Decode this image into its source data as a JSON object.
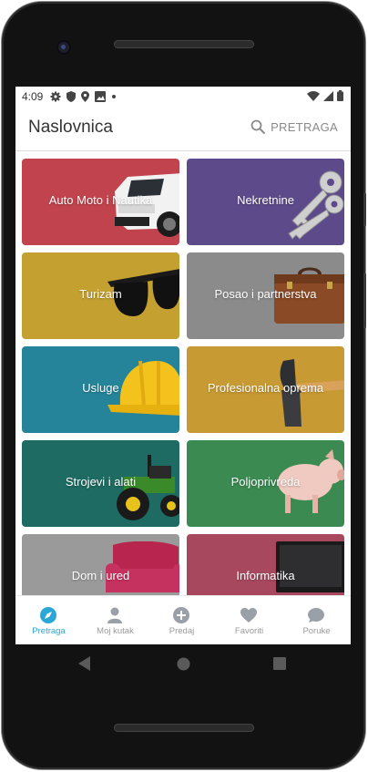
{
  "status_bar": {
    "time": "4:09",
    "left_icons": [
      "gear-icon",
      "shield-icon",
      "location-icon",
      "image-icon",
      "dot-icon"
    ],
    "right_icons": [
      "wifi-icon",
      "cell-signal-icon",
      "battery-icon"
    ]
  },
  "app_bar": {
    "title": "Naslovnica",
    "search_label": "PRETRAGA"
  },
  "categories": [
    {
      "label": "Auto Moto i Nautika",
      "color": "#c1434d",
      "icon": "car-icon"
    },
    {
      "label": "Nekretnine",
      "color": "#5d4a8a",
      "icon": "keys-icon"
    },
    {
      "label": "Turizam",
      "color": "#c4a031",
      "icon": "sunglasses-icon"
    },
    {
      "label": "Posao i partnerstva",
      "color": "#8b8b8b",
      "icon": "briefcase-icon"
    },
    {
      "label": "Usluge",
      "color": "#25849a",
      "icon": "hard-hat-icon"
    },
    {
      "label": "Profesionalna oprema",
      "color": "#c79a33",
      "icon": "hammer-icon"
    },
    {
      "label": "Strojevi i alati",
      "color": "#1d6b62",
      "icon": "tractor-icon"
    },
    {
      "label": "Poljoprivreda",
      "color": "#3b8a52",
      "icon": "pig-icon"
    },
    {
      "label": "Dom i ured",
      "color": "#9a9a9a",
      "icon": "sofa-icon"
    },
    {
      "label": "Informatika",
      "color": "#a8485f",
      "icon": "monitor-icon"
    }
  ],
  "bottom_nav": {
    "items": [
      {
        "label": "Pretraga",
        "icon": "compass-icon",
        "active": true
      },
      {
        "label": "Moj kutak",
        "icon": "person-icon",
        "active": false
      },
      {
        "label": "Predaj",
        "icon": "plus-circle-icon",
        "active": false
      },
      {
        "label": "Favoriti",
        "icon": "heart-icon",
        "active": false
      },
      {
        "label": "Poruke",
        "icon": "chat-icon",
        "active": false
      }
    ],
    "active_color": "#2aa7d6",
    "inactive_color": "#9a9a9a"
  },
  "system_nav": [
    "back-icon",
    "home-icon",
    "recents-icon"
  ]
}
